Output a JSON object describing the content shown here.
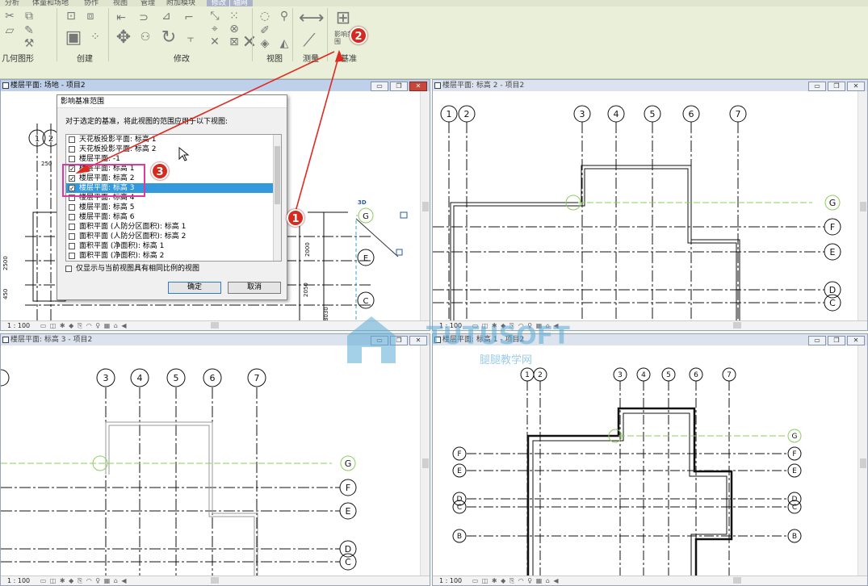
{
  "ribbon": {
    "tabs": [
      "分析",
      "体量和场地",
      "协作",
      "视图",
      "管理",
      "附加模块",
      "修改 | 轴网"
    ],
    "active_tab_index": 6,
    "panels": [
      {
        "label": "几何图形"
      },
      {
        "label": "创建"
      },
      {
        "label": "修改"
      },
      {
        "label": "视图"
      },
      {
        "label": "测量"
      },
      {
        "label": "基准"
      }
    ],
    "datum_button_label": "影响范围"
  },
  "views": [
    {
      "title": "楼层平面: 场地 - 项目2",
      "scale": "1 : 100",
      "active": true
    },
    {
      "title": "楼层平面: 标高 2 - 项目2",
      "scale": "1 : 100",
      "active": false
    },
    {
      "title": "楼层平面: 标高 3 - 项目2",
      "scale": "1 : 100",
      "active": false
    },
    {
      "title": "楼层平面: 标高 1 - 项目2",
      "scale": "1 : 100",
      "active": false
    }
  ],
  "window_buttons": {
    "minimize": "▭",
    "restore": "❐",
    "close": "✕"
  },
  "status_icons": "▭ ◫ ✱ ◆ ⎘ ◠ ♀ ▦ ⌂ ◀",
  "dialog": {
    "title": "影响基准范围",
    "description": "对于选定的基准，将此视图的范围应用于以下视图:",
    "items": [
      {
        "label": "天花板投影平面: 标高 1",
        "checked": false,
        "selected": false
      },
      {
        "label": "天花板投影平面: 标高 2",
        "checked": false,
        "selected": false
      },
      {
        "label": "楼层平面: -1",
        "checked": false,
        "selected": false
      },
      {
        "label": "楼层平面: 标高 1",
        "checked": true,
        "selected": false
      },
      {
        "label": "楼层平面: 标高 2",
        "checked": true,
        "selected": false
      },
      {
        "label": "楼层平面: 标高 3",
        "checked": true,
        "selected": true
      },
      {
        "label": "楼层平面: 标高 4",
        "checked": false,
        "selected": false
      },
      {
        "label": "楼层平面: 标高 5",
        "checked": false,
        "selected": false
      },
      {
        "label": "楼层平面: 标高 6",
        "checked": false,
        "selected": false
      },
      {
        "label": "面积平面 (人防分区面积): 标高 1",
        "checked": false,
        "selected": false
      },
      {
        "label": "面积平面 (人防分区面积): 标高 2",
        "checked": false,
        "selected": false
      },
      {
        "label": "面积平面 (净面积): 标高 1",
        "checked": false,
        "selected": false
      },
      {
        "label": "面积平面 (净面积): 标高 2",
        "checked": false,
        "selected": false
      }
    ],
    "same_scale_checkbox": {
      "label": "仅显示与当前视图具有相同比例的视图",
      "checked": false
    },
    "ok_label": "确定",
    "cancel_label": "取消"
  },
  "callouts": [
    "1",
    "2",
    "3"
  ],
  "grid_labels": {
    "view1_top": [
      "1",
      "2"
    ],
    "view1_right": [
      "G",
      "E",
      "C"
    ],
    "view1_dims": [
      "250",
      "2500",
      "450",
      "2000",
      "2050",
      "8030"
    ],
    "view1_3d": "3D",
    "view2_top": [
      "1",
      "2",
      "3",
      "4",
      "5",
      "6",
      "7"
    ],
    "view2_right": [
      "G",
      "F",
      "E",
      "D",
      "C"
    ],
    "view3_top": [
      "3",
      "4",
      "5",
      "6",
      "7"
    ],
    "view3_right": [
      "G",
      "F",
      "E",
      "D",
      "C"
    ],
    "view4_top": [
      "1",
      "2",
      "3",
      "4",
      "5",
      "6",
      "7"
    ],
    "view4_left": [
      "F",
      "E",
      "D",
      "C",
      "B"
    ],
    "view4_right": [
      "G",
      "F",
      "E",
      "D",
      "C",
      "B"
    ]
  },
  "watermark": {
    "brand": "TUTUSOFT",
    "subtitle": "腿腿教学网"
  },
  "colors": {
    "accent": "#3399dd",
    "callout": "#d7291e",
    "highlight": "#e0389c",
    "grid_green": "#8ccf5a"
  }
}
